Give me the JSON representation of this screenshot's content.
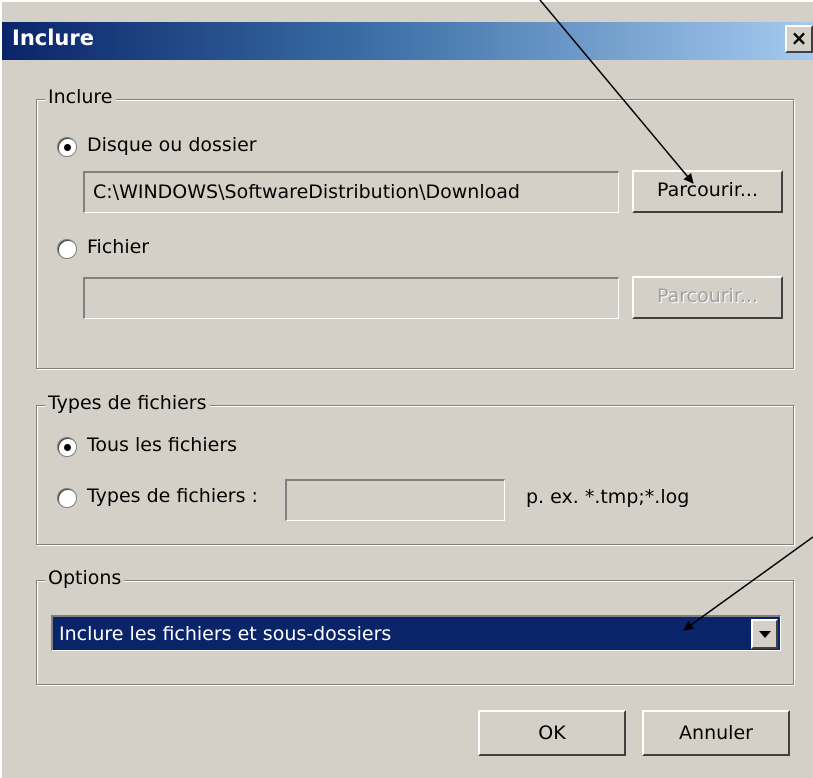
{
  "window": {
    "title": "Inclure",
    "close_glyph": "×"
  },
  "include_group": {
    "legend": "Inclure",
    "option_folder": {
      "label": "Disque ou dossier",
      "selected": true,
      "path_value": "C:\\WINDOWS\\SoftwareDistribution\\Download",
      "browse_label": "Parcourir..."
    },
    "option_file": {
      "label": "Fichier",
      "selected": false,
      "path_value": "",
      "browse_label": "Parcourir..."
    }
  },
  "file_types_group": {
    "legend": "Types de fichiers",
    "option_all": {
      "label": "Tous les fichiers",
      "selected": true
    },
    "option_types": {
      "label": "Types de fichiers :",
      "selected": false,
      "value": "",
      "hint": "p. ex. *.tmp;*.log"
    }
  },
  "options_group": {
    "legend": "Options",
    "selected_value": "Inclure les fichiers et sous-dossiers"
  },
  "footer": {
    "ok_label": "OK",
    "cancel_label": "Annuler"
  },
  "colors": {
    "face": "#d4d0c8",
    "title_start": "#0a246a",
    "title_end": "#a6caf0",
    "selection": "#0a246a"
  }
}
